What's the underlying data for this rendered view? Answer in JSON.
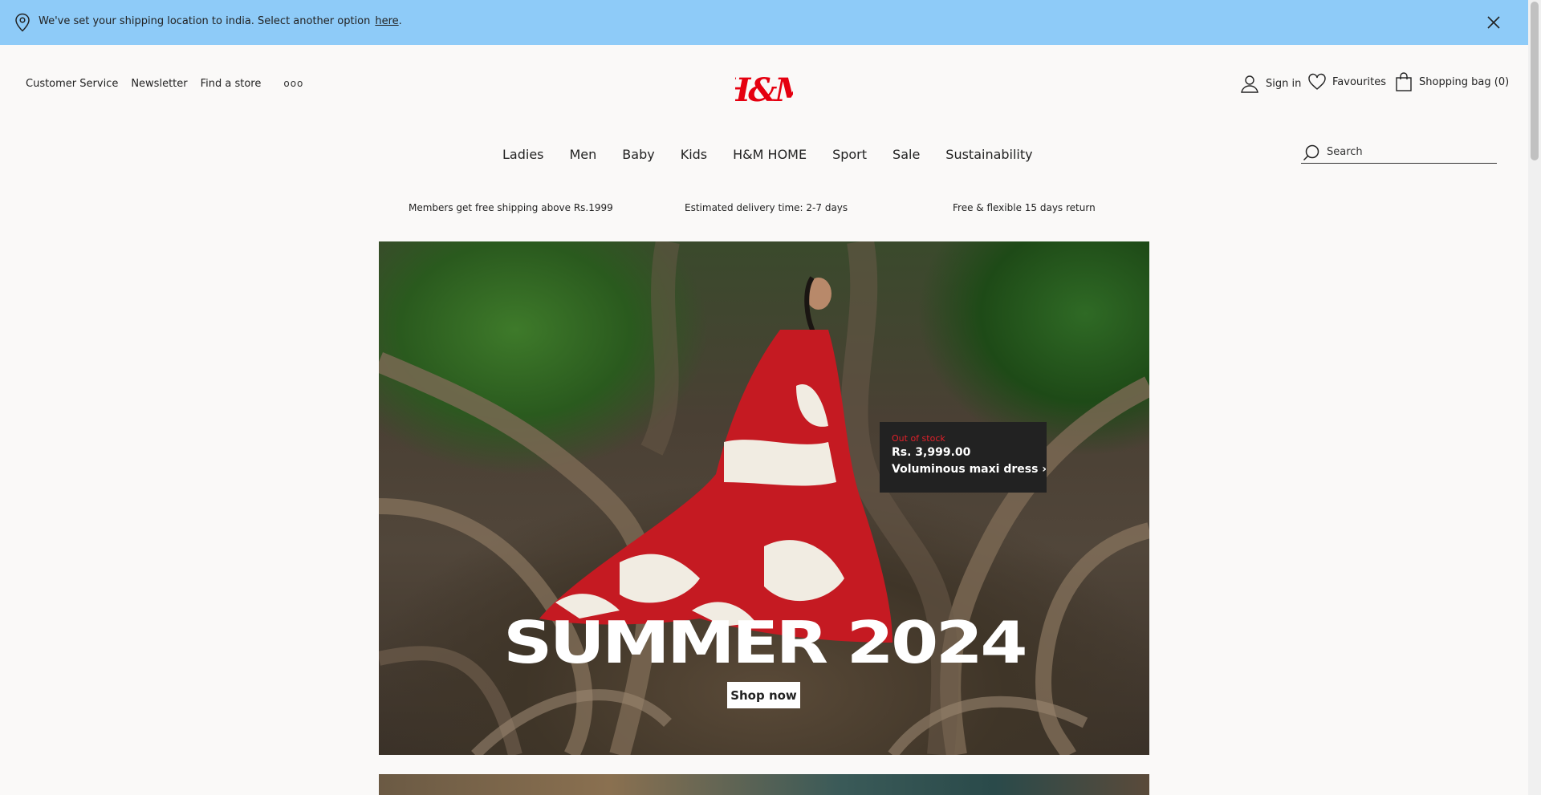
{
  "notice": {
    "message": "We've set your shipping location to india. Select another option",
    "link_text": "here",
    "suffix": "."
  },
  "utility_left": {
    "customer_service": "Customer Service",
    "newsletter": "Newsletter",
    "find_store": "Find a store",
    "more": "ooo"
  },
  "logo": {
    "text": "H&M",
    "color": "#e50010"
  },
  "utility_right": {
    "sign_in": "Sign in",
    "favourites": "Favourites",
    "shopping_bag": "Shopping bag (0)"
  },
  "nav": {
    "items": [
      {
        "label": "Ladies"
      },
      {
        "label": "Men"
      },
      {
        "label": "Baby"
      },
      {
        "label": "Kids"
      },
      {
        "label": "H&M HOME"
      },
      {
        "label": "Sport"
      },
      {
        "label": "Sale"
      },
      {
        "label": "Sustainability"
      }
    ]
  },
  "search": {
    "placeholder": "Search"
  },
  "usps": {
    "shipping": "Members get free shipping above Rs.1999",
    "delivery": "Estimated delivery time: 2-7 days",
    "returns": "Free & flexible 15 days return"
  },
  "hero": {
    "product_tag": {
      "status": "Out of stock",
      "price": "Rs. 3,999.00",
      "name": "Voluminous maxi dress ›"
    },
    "headline": "SUMMER 2024",
    "cta": "Shop now"
  },
  "colors": {
    "notice_bg": "#8ecbf8",
    "page_bg": "#faf9f8",
    "brand_red": "#e50010",
    "tag_bg": "#222222",
    "out_of_stock": "#e0202a"
  },
  "icons": [
    "location-pin-icon",
    "close-icon",
    "user-icon",
    "heart-icon",
    "bag-icon",
    "search-icon"
  ]
}
